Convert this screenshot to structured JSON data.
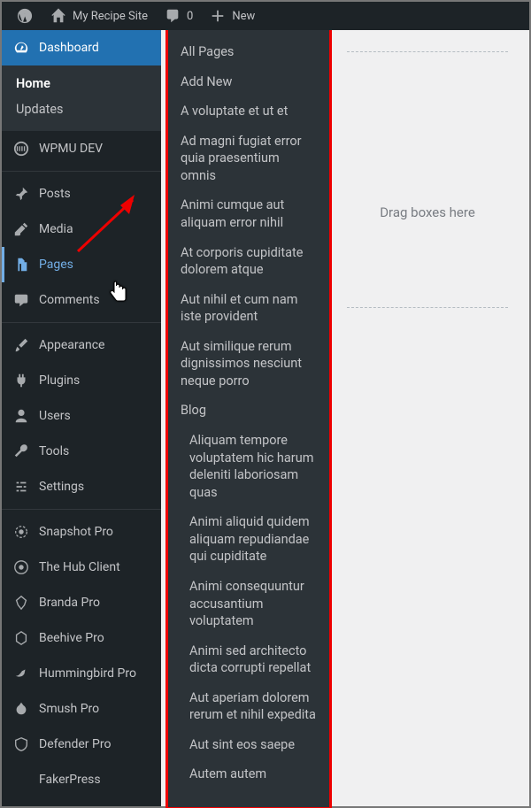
{
  "adminbar": {
    "site_name": "My Recipe Site",
    "comment_count": "0",
    "new_label": "New"
  },
  "sidebar": {
    "dashboard": "Dashboard",
    "dashboard_sub": {
      "home": "Home",
      "updates": "Updates"
    },
    "items": [
      {
        "key": "wpmudev",
        "label": "WPMU DEV"
      },
      {
        "key": "posts",
        "label": "Posts"
      },
      {
        "key": "media",
        "label": "Media"
      },
      {
        "key": "pages",
        "label": "Pages"
      },
      {
        "key": "comments",
        "label": "Comments"
      },
      {
        "key": "appearance",
        "label": "Appearance"
      },
      {
        "key": "plugins",
        "label": "Plugins"
      },
      {
        "key": "users",
        "label": "Users"
      },
      {
        "key": "tools",
        "label": "Tools"
      },
      {
        "key": "settings",
        "label": "Settings"
      },
      {
        "key": "snapshot",
        "label": "Snapshot Pro"
      },
      {
        "key": "hubclient",
        "label": "The Hub Client"
      },
      {
        "key": "branda",
        "label": "Branda Pro"
      },
      {
        "key": "beehive",
        "label": "Beehive Pro"
      },
      {
        "key": "hummingbird",
        "label": "Hummingbird Pro"
      },
      {
        "key": "smush",
        "label": "Smush Pro"
      },
      {
        "key": "defender",
        "label": "Defender Pro"
      },
      {
        "key": "fakerpress",
        "label": "FakerPress"
      }
    ]
  },
  "flyout": {
    "items": [
      {
        "label": "All Pages",
        "indent": false
      },
      {
        "label": "Add New",
        "indent": false
      },
      {
        "label": "A voluptate et ut et",
        "indent": false
      },
      {
        "label": "Ad magni fugiat error quia praesentium omnis",
        "indent": false
      },
      {
        "label": "Animi cumque aut aliquam error nihil",
        "indent": false
      },
      {
        "label": "At corporis cupiditate dolorem atque",
        "indent": false
      },
      {
        "label": "Aut nihil et cum nam iste provident",
        "indent": false
      },
      {
        "label": "Aut similique rerum dignissimos nesciunt neque porro",
        "indent": false
      },
      {
        "label": "Blog",
        "indent": false
      },
      {
        "label": "Aliquam tempore voluptatem hic harum deleniti laboriosam quas",
        "indent": true
      },
      {
        "label": "Animi aliquid quidem aliquam repudiandae qui cupiditate",
        "indent": true
      },
      {
        "label": "Animi consequuntur accusantium voluptatem",
        "indent": true
      },
      {
        "label": "Animi sed architecto dicta corrupti repellat",
        "indent": true
      },
      {
        "label": "Aut aperiam dolorem rerum et nihil expedita",
        "indent": true
      },
      {
        "label": "Aut sint eos saepe",
        "indent": true
      },
      {
        "label": "Autem autem",
        "indent": true
      }
    ]
  },
  "content": {
    "dropzone": "Drag boxes here"
  }
}
